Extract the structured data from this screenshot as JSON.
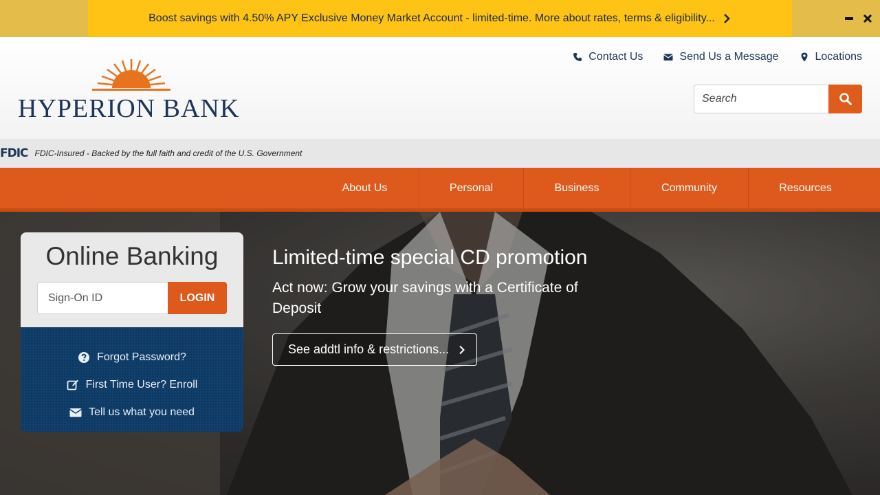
{
  "promo_banner": {
    "text": "Boost savings with 4.50% APY Exclusive Money Market Account - limited-time. More about rates, terms & eligibility...",
    "icons": [
      "chevron-right-icon",
      "minimize-icon",
      "close-icon"
    ]
  },
  "header": {
    "logo_text": "HYPERION BANK",
    "top_links": [
      {
        "label": "Contact Us",
        "icon": "phone-icon"
      },
      {
        "label": "Send Us a Message",
        "icon": "envelope-icon"
      },
      {
        "label": "Locations",
        "icon": "map-marker-icon"
      }
    ],
    "search": {
      "placeholder": "Search",
      "icon": "search-icon"
    }
  },
  "fdic": {
    "logo": "FDIC",
    "text": "FDIC-Insured - Backed by the full faith and credit of the U.S. Government"
  },
  "nav": {
    "items": [
      {
        "label": "About Us"
      },
      {
        "label": "Personal"
      },
      {
        "label": "Business"
      },
      {
        "label": "Community"
      },
      {
        "label": "Resources"
      }
    ]
  },
  "online_banking": {
    "title": "Online Banking",
    "signon_placeholder": "Sign-On ID",
    "login_label": "LOGIN",
    "links": [
      {
        "label": "Forgot Password?",
        "icon": "question-circle-icon"
      },
      {
        "label": "First Time User? Enroll",
        "icon": "edit-icon"
      },
      {
        "label": "Tell us what you need",
        "icon": "envelope-icon"
      }
    ]
  },
  "hero_promo": {
    "heading": "Limited-time special CD promotion",
    "subtext": "Act now: Grow your savings with a Certificate of Deposit",
    "button_label": "See addtl info & restrictions..."
  },
  "colors": {
    "banner_yellow": "#fec315",
    "brand_orange": "#dd5a1c",
    "brand_navy": "#1d3557",
    "login_panel_blue": "#0e3a66"
  }
}
